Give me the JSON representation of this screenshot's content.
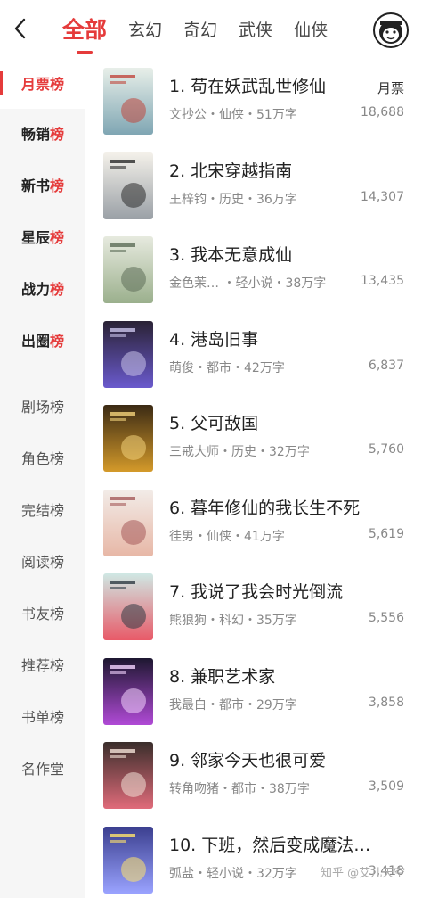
{
  "header": {
    "tabs": [
      "全部",
      "玄幻",
      "奇幻",
      "武侠",
      "仙侠"
    ],
    "active_tab": 0
  },
  "icons": {
    "back": "chevron-left-icon",
    "avatar": "monkey-avatar-icon"
  },
  "sidebar": {
    "items": [
      {
        "label_main": "月票",
        "label_suffix": "榜",
        "state": "active"
      },
      {
        "label_main": "畅销",
        "label_suffix": "榜",
        "state": "strong"
      },
      {
        "label_main": "新书",
        "label_suffix": "榜",
        "state": "strong"
      },
      {
        "label_main": "星辰",
        "label_suffix": "榜",
        "state": "strong"
      },
      {
        "label_main": "战力",
        "label_suffix": "榜",
        "state": "strong"
      },
      {
        "label_main": "出圈",
        "label_suffix": "榜",
        "state": "strong"
      },
      {
        "label_main": "剧场榜",
        "label_suffix": "",
        "state": "weak"
      },
      {
        "label_main": "角色榜",
        "label_suffix": "",
        "state": "weak"
      },
      {
        "label_main": "完结榜",
        "label_suffix": "",
        "state": "weak"
      },
      {
        "label_main": "阅读榜",
        "label_suffix": "",
        "state": "weak"
      },
      {
        "label_main": "书友榜",
        "label_suffix": "",
        "state": "weak"
      },
      {
        "label_main": "推荐榜",
        "label_suffix": "",
        "state": "weak"
      },
      {
        "label_main": "书单榜",
        "label_suffix": "",
        "state": "weak"
      },
      {
        "label_main": "名作堂",
        "label_suffix": "",
        "state": "weak"
      }
    ]
  },
  "list": {
    "column_label": "月票",
    "books": [
      {
        "title": "1. 苟在妖武乱世修仙",
        "meta": "文抄公・仙侠・51万字",
        "count": "18,688",
        "cover": [
          "#e8efe9",
          "#7fa6b3",
          "#c0473e"
        ]
      },
      {
        "title": "2. 北宋穿越指南",
        "meta": "王梓钧・历史・36万字",
        "count": "14,307",
        "cover": [
          "#f4f1ea",
          "#9aa0a6",
          "#2b2b2b"
        ]
      },
      {
        "title": "3. 我本无意成仙",
        "meta": "金色茉…  ・轻小说・38万字",
        "count": "13,435",
        "cover": [
          "#e7eadf",
          "#9bb08d",
          "#5c6d57"
        ]
      },
      {
        "title": "4. 港岛旧事",
        "meta": "萌俊・都市・42万字",
        "count": "6,837",
        "cover": [
          "#2a2235",
          "#6a5acd",
          "#c9c3ea"
        ]
      },
      {
        "title": "5. 父可敌国",
        "meta": "三戒大师・历史・32万字",
        "count": "5,760",
        "cover": [
          "#3b2a14",
          "#d49a2a",
          "#f2d27a"
        ]
      },
      {
        "title": "6. 暮年修仙的我长生不死",
        "meta": "徍男・仙侠・41万字",
        "count": "5,619",
        "cover": [
          "#f2ece8",
          "#e7b7a6",
          "#a55a5a"
        ]
      },
      {
        "title": "7. 我说了我会时光倒流",
        "meta": "熊狼狗・科幻・35万字",
        "count": "5,556",
        "cover": [
          "#cfe8e4",
          "#e85a68",
          "#2f3b44"
        ]
      },
      {
        "title": "8. 兼职艺术家",
        "meta": "我最白・都市・29万字",
        "count": "3,858",
        "cover": [
          "#1d1730",
          "#b04ad6",
          "#f4d4ff"
        ]
      },
      {
        "title": "9. 邻家今天也很可爱",
        "meta": "转角吻猪・都市・38万字",
        "count": "3,509",
        "cover": [
          "#3a2e2b",
          "#e06b7a",
          "#f3e1d7"
        ]
      },
      {
        "title": "10. 下班，然后变成魔法…",
        "meta": "弧盐・轻小说・32万字",
        "count": "3,418",
        "cover": [
          "#3b3f8f",
          "#9aa3ff",
          "#ffe36b"
        ]
      }
    ]
  },
  "watermark": "知乎 @艾儿天空"
}
